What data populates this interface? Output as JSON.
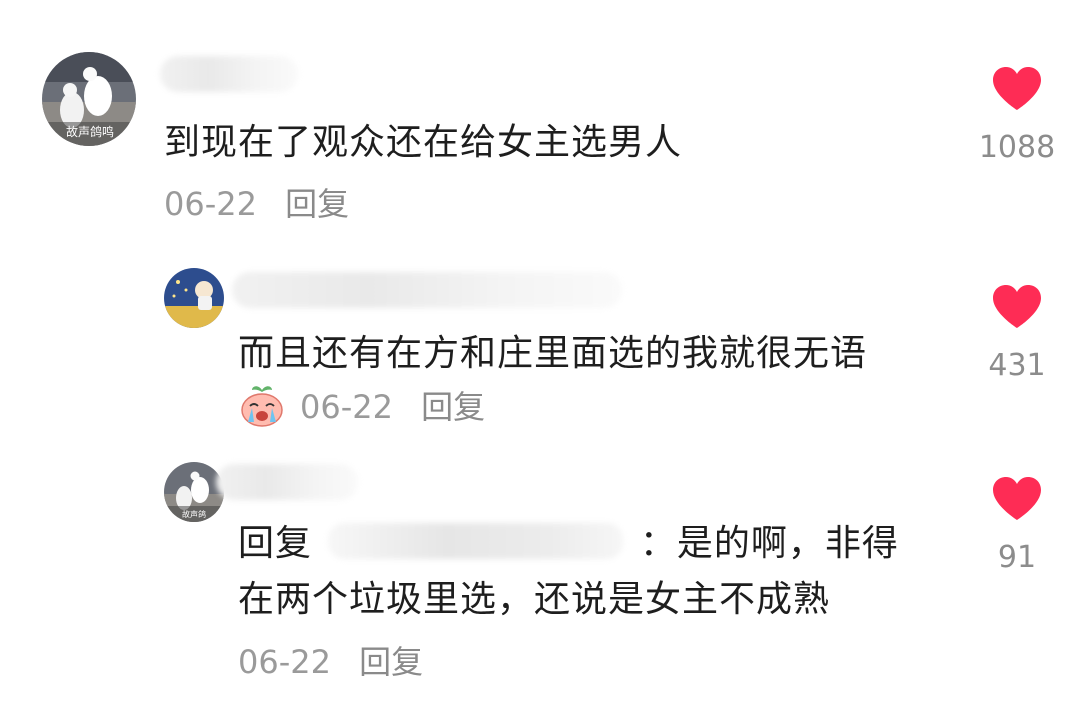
{
  "comments": [
    {
      "text": "到现在了观众还在给女主选男人",
      "date": "06-22",
      "reply_label": "回复",
      "likes": "1088",
      "avatar_text": "故声鸽鸣"
    },
    {
      "text": "而且还有在方和庄里面选的我就很无语",
      "date": "06-22",
      "reply_label": "回复",
      "likes": "431",
      "sticker": "crying-peach-sticker"
    },
    {
      "reply_prefix": "回复",
      "text_line1_end": "：是的啊，非得",
      "text_line2": "在两个垃圾里选，还说是女主不成熟",
      "date": "06-22",
      "reply_label": "回复",
      "likes": "91",
      "avatar_text": "故声鸽"
    }
  ],
  "colors": {
    "heart": "#fe2c55",
    "meta_gray": "#9a9a9a",
    "text": "#1e1e1e"
  },
  "icons": [
    "heart-icon",
    "avatar-pigeons",
    "avatar-illustration",
    "crying-peach-sticker"
  ]
}
